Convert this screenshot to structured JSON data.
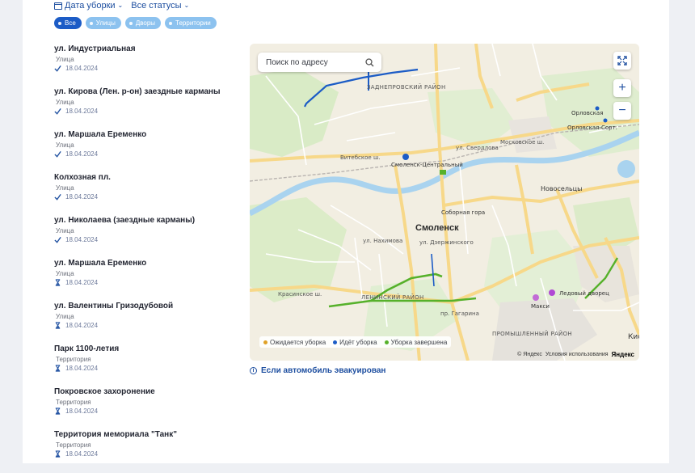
{
  "filters": {
    "date_label": "Дата уборки",
    "status_label": "Все статусы"
  },
  "chips": [
    {
      "label": "Все",
      "active": true
    },
    {
      "label": "Улицы",
      "active": false
    },
    {
      "label": "Дворы",
      "active": false
    },
    {
      "label": "Территории",
      "active": false
    }
  ],
  "items": [
    {
      "name": "ул. Индустриальная",
      "type": "Улица",
      "date": "18.04.2024",
      "status_icon": "check-icon"
    },
    {
      "name": "ул. Кирова (Лен. р-он) заездные карманы",
      "type": "Улица",
      "date": "18.04.2024",
      "status_icon": "check-icon"
    },
    {
      "name": "ул. Маршала Еременко",
      "type": "Улица",
      "date": "18.04.2024",
      "status_icon": "check-icon"
    },
    {
      "name": "Колхозная пл.",
      "type": "Улица",
      "date": "18.04.2024",
      "status_icon": "check-icon"
    },
    {
      "name": "ул. Николаева (заездные карманы)",
      "type": "Улица",
      "date": "18.04.2024",
      "status_icon": "check-icon"
    },
    {
      "name": "ул. Маршала Еременко",
      "type": "Улица",
      "date": "18.04.2024",
      "status_icon": "hourglass-icon"
    },
    {
      "name": "ул. Валентины Гризодубовой",
      "type": "Улица",
      "date": "18.04.2024",
      "status_icon": "hourglass-icon"
    },
    {
      "name": "Парк 1100-летия",
      "type": "Территория",
      "date": "18.04.2024",
      "status_icon": "hourglass-icon"
    },
    {
      "name": "Покровское захоронение",
      "type": "Территория",
      "date": "18.04.2024",
      "status_icon": "hourglass-icon"
    },
    {
      "name": "Территория мемориала \"Танк\"",
      "type": "Территория",
      "date": "18.04.2024",
      "status_icon": "hourglass-icon"
    }
  ],
  "map": {
    "search_placeholder": "Поиск по адресу",
    "city_label": "Смоленск",
    "legend": [
      {
        "label": "Ожидается уборка",
        "color": "#e0a126"
      },
      {
        "label": "Идёт уборка",
        "color": "#1c5cc6"
      },
      {
        "label": "Уборка завершена",
        "color": "#56b12b"
      }
    ],
    "copyright": "© Яндекс",
    "terms": "Условия использования",
    "brand": "Яндекс",
    "labels": {
      "zadneprovsky": "ЗАДНЕПРОВСКИЙ РАЙОН",
      "leninsky": "ЛЕНИНСКИЙ РАЙОН",
      "promyshlenny": "ПРОМЫШЛЕННЫЙ РАЙОН",
      "novoseltsy": "Новосельцы",
      "orlovskaya": "Орловская",
      "orlovskaya_sort": "Орловская-Сорт.",
      "station": "Смоленск-Центральный",
      "sobornaya": "Соборная гора",
      "ledovy": "Ледовый дворец",
      "maxi": "Макси",
      "nakhimova": "ул. Нахимова",
      "dzerzhinskogo": "ул. Дзержинского",
      "krasninskoe": "Красинское ш.",
      "gagarina": "пр. Гагарина",
      "vitebskoe": "Витебское ш.",
      "sverdlova": "ул. Свердлова",
      "moskovskoe": "Московское ш.",
      "kis": "Кис"
    }
  },
  "evacuation_link": "Если автомобиль эвакуирован"
}
